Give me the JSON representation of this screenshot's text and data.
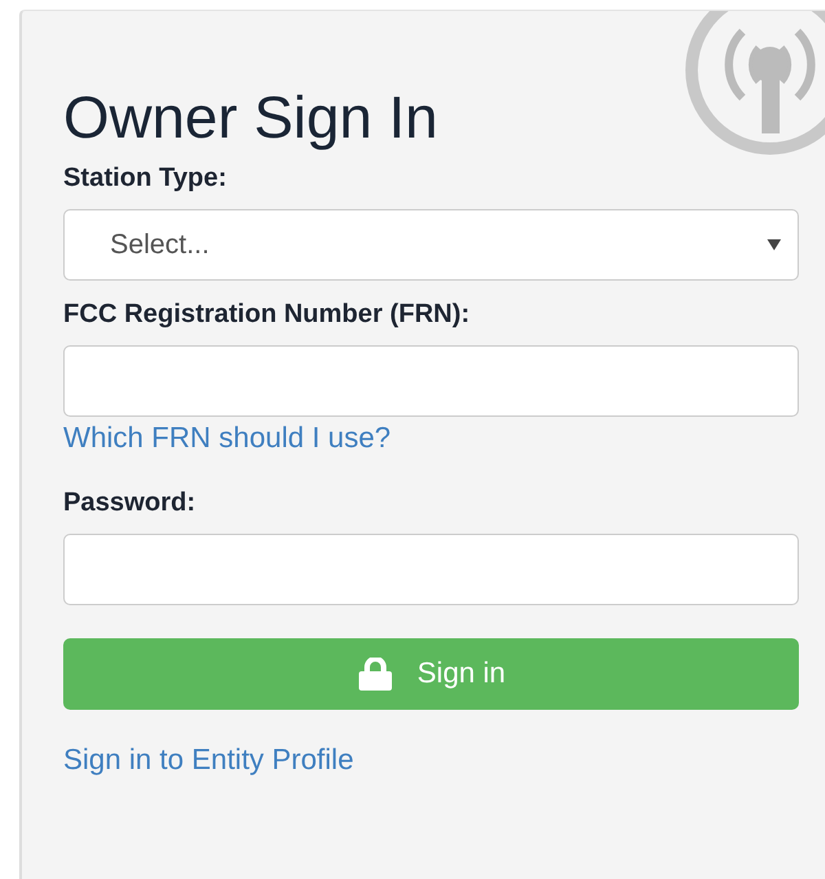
{
  "title": "Owner Sign In",
  "fields": [
    {
      "kind": "select",
      "label": "Station Type:",
      "placeholder": "Select..."
    },
    {
      "kind": "text",
      "label": "FCC Registration Number (FRN):",
      "help_link": "Which FRN should I use?"
    },
    {
      "kind": "password",
      "label": "Password:"
    }
  ],
  "submit_button": "Sign in",
  "entity_link": "Sign in to Entity Profile"
}
